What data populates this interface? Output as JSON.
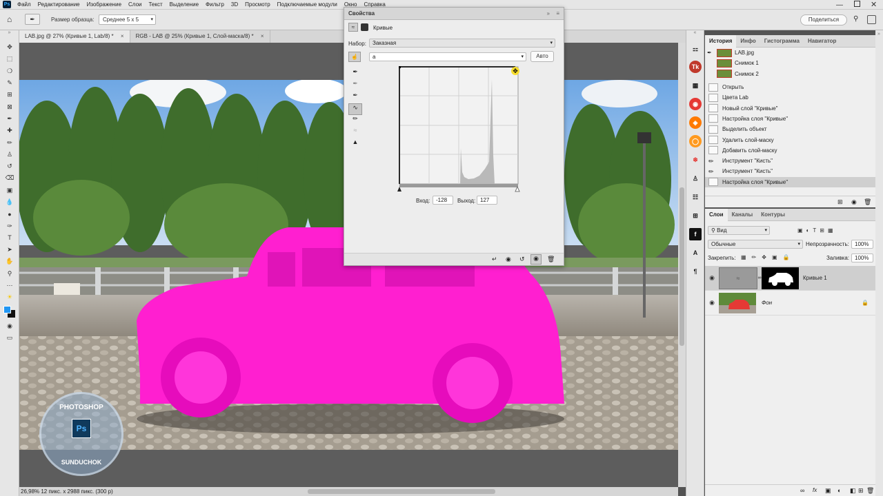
{
  "menu": {
    "app_icon": "Ps",
    "items": [
      "Файл",
      "Редактирование",
      "Изображение",
      "Слои",
      "Текст",
      "Выделение",
      "Фильтр",
      "3D",
      "Просмотр",
      "Подключаемые модули",
      "Окно",
      "Справка"
    ]
  },
  "options_bar": {
    "sample_size_label": "Размер образца:",
    "sample_size_value": "Среднее 5 x 5",
    "share_button": "Поделиться"
  },
  "doc_tabs": [
    {
      "label": "LAB.jpg @ 27% (Кривые 1, Lab/8) *"
    },
    {
      "label": "RGB - LAB @ 25% (Кривые 1, Слой-маска/8) *"
    }
  ],
  "watermark": {
    "top_text": "PHOTOSHOP",
    "bottom_text": "SUNDUCHOK",
    "badge": "Ps"
  },
  "status": {
    "text": "26,98%   12 пикс. x 2988 пикс. (300 р)"
  },
  "properties": {
    "title": "Свойства",
    "layer_type": "Кривые",
    "preset_label": "Набор:",
    "preset_value": "Заказная",
    "channel_value": "a",
    "auto_button": "Авто",
    "input_label": "Вход:",
    "input_value": "-128",
    "output_label": "Выход:",
    "output_value": "127"
  },
  "history": {
    "tabs": [
      "История",
      "Инфо",
      "Гистограмма",
      "Навигатор"
    ],
    "snapshots": [
      "LAB.jpg",
      "Снимок 1",
      "Снимок 2"
    ],
    "steps": [
      "Открыть",
      "Цвета Lab",
      "Новый слой \"Кривые\"",
      "Настройка слоя \"Кривые\"",
      "Выделить объект",
      "Удалить слой-маску",
      "Добавить слой-маску",
      "Инструмент \"Кисть\"",
      "Инструмент \"Кисть\"",
      "Настройка слоя \"Кривые\""
    ]
  },
  "layers": {
    "tabs": [
      "Слои",
      "Каналы",
      "Контуры"
    ],
    "filter_label": "Вид",
    "blend_mode": "Обычные",
    "opacity_label": "Непрозрачность:",
    "opacity_value": "100%",
    "lock_label": "Закрепить:",
    "fill_label": "Заливка:",
    "fill_value": "100%",
    "items": [
      {
        "name": "Кривые 1"
      },
      {
        "name": "Фон"
      }
    ]
  },
  "colors": {
    "pink": "#ff1fd0",
    "sky": "#7fb2e6",
    "foreground": "#2196f3",
    "background": "#111111"
  }
}
